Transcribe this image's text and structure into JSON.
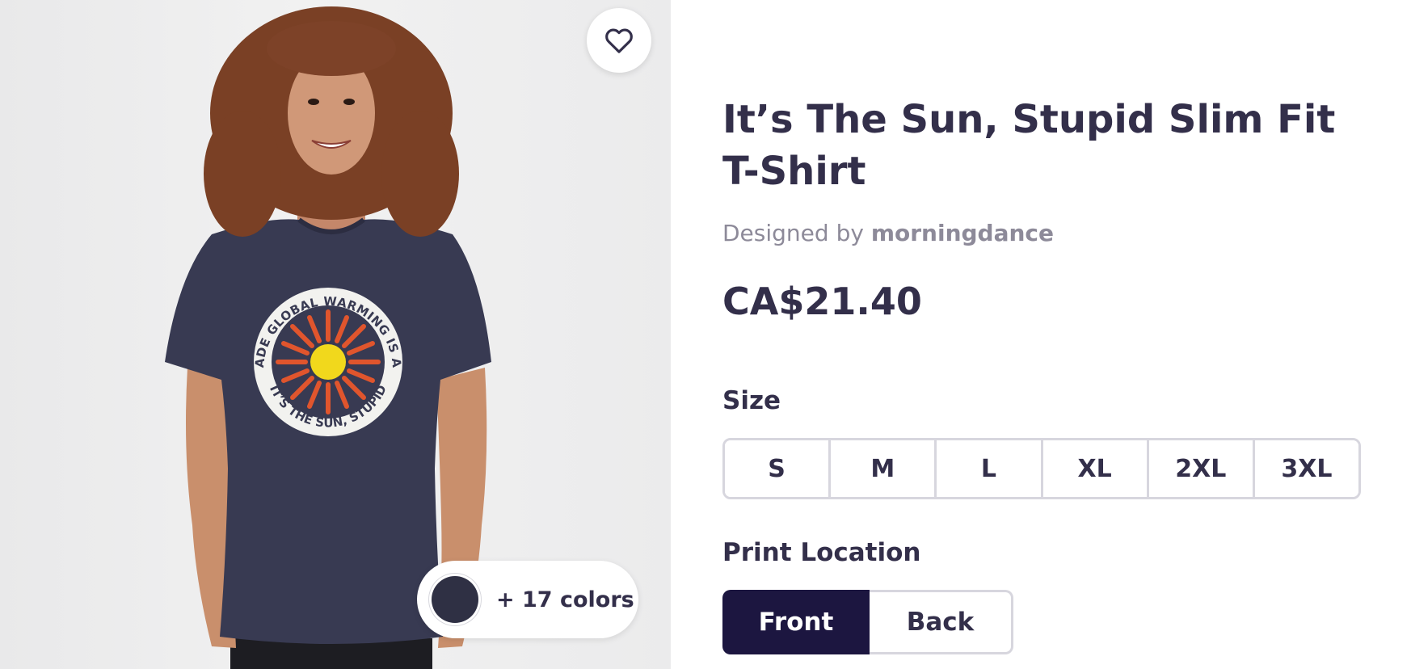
{
  "product": {
    "title": "It’s The Sun, Stupid Slim Fit T-Shirt",
    "designed_by_prefix": "Designed by",
    "designer": "morningdance",
    "price": "CA$21.40"
  },
  "image": {
    "shirt_graphic": {
      "arc_top": "MANMADE GLOBAL WARMING IS A HOAX",
      "arc_bottom": "IT’S THE SUN, STUPID"
    },
    "favorite_icon": "heart-outline-icon",
    "colors": {
      "selected_swatch": "#2f3044",
      "more_label": "+ 17 colors"
    }
  },
  "size": {
    "heading": "Size",
    "options": [
      "S",
      "M",
      "L",
      "XL",
      "2XL",
      "3XL"
    ]
  },
  "print_location": {
    "heading": "Print Location",
    "options": [
      "Front",
      "Back"
    ],
    "selected": "Front"
  },
  "colors": {
    "text_primary": "#332f4a",
    "text_muted": "#8d8a99",
    "selected_button": "#1c1640",
    "border": "#d7d6de"
  }
}
